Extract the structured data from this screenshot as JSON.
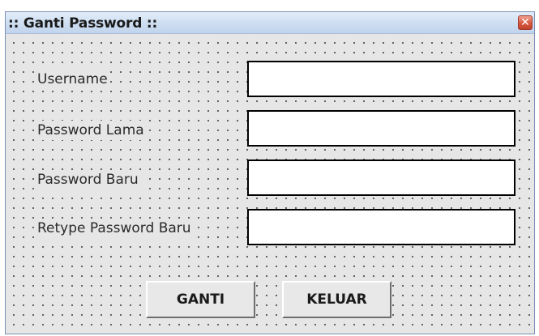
{
  "window": {
    "title": ":: Ganti Password ::",
    "close_icon": "close-icon",
    "close_glyph": "✕"
  },
  "form": {
    "username_label": "Username",
    "username_value": "",
    "password_lama_label": "Password Lama",
    "password_lama_value": "",
    "password_baru_label": "Password Baru",
    "password_baru_value": "",
    "retype_password_baru_label": "Retype Password Baru",
    "retype_password_baru_value": ""
  },
  "buttons": {
    "ganti_label": "GANTI",
    "keluar_label": "KELUAR"
  },
  "colors": {
    "titlebar": "#cfdff2",
    "close_button": "#d8573f",
    "form_background": "#e6e6e6"
  }
}
